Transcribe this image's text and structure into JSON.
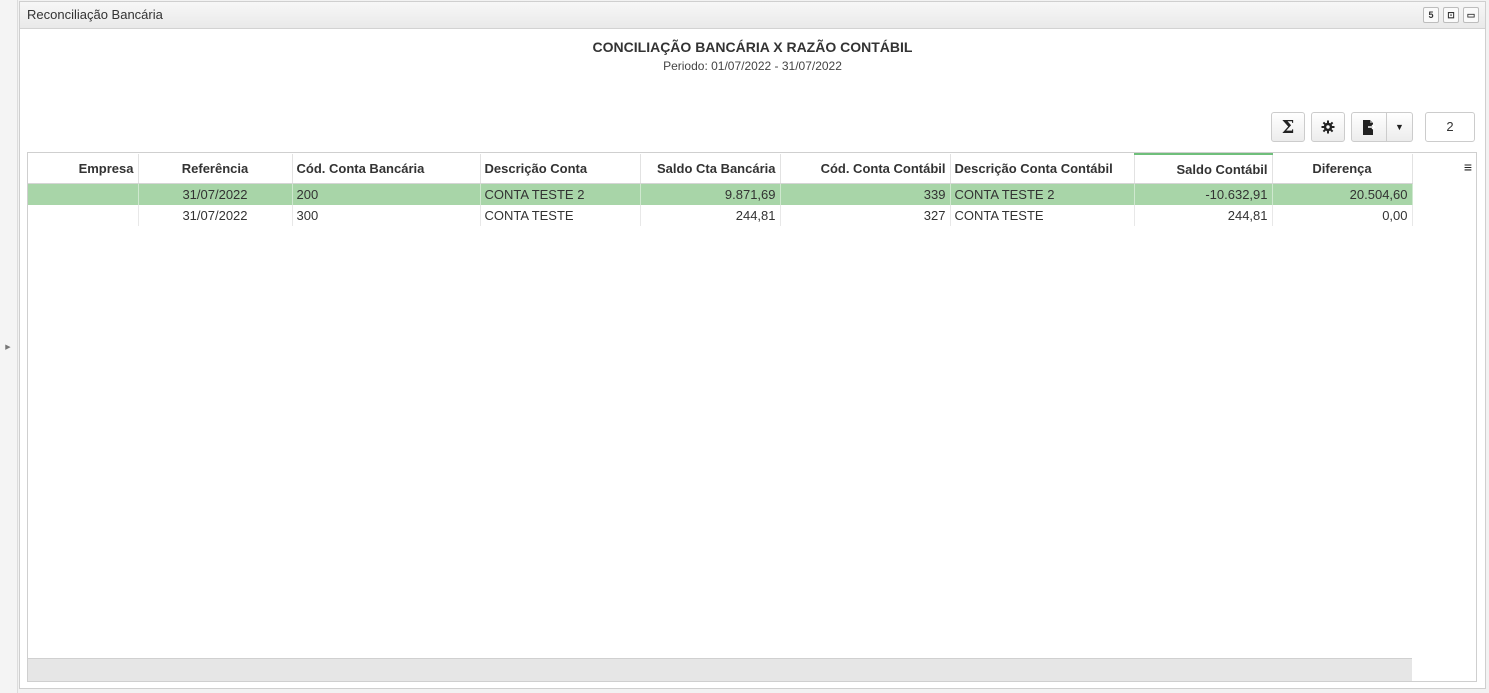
{
  "panel": {
    "title": "Reconciliação Bancária",
    "buttons": [
      "5",
      "⊡",
      "▭"
    ]
  },
  "report": {
    "title": "CONCILIAÇÃO BANCÁRIA X RAZÃO CONTÁBIL",
    "period": "Periodo: 01/07/2022 - 31/07/2022"
  },
  "toolbar": {
    "sum_icon": "sigma-icon",
    "settings_icon": "gear-icon",
    "export_icon": "export-file-icon",
    "dropdown_icon": "caret-down-icon",
    "row_count": "2"
  },
  "grid": {
    "columns": [
      "Empresa",
      "Referência",
      "Cód. Conta Bancária",
      "Descrição Conta",
      "Saldo Cta Bancária",
      "Cód. Conta Contábil",
      "Descrição Conta Contábil",
      "Saldo Contábil",
      "Diferença"
    ],
    "rows": [
      [
        "",
        "31/07/2022",
        "200",
        "CONTA TESTE 2",
        "9.871,69",
        "339",
        "CONTA TESTE 2",
        "-10.632,91",
        "20.504,60"
      ],
      [
        "",
        "31/07/2022",
        "300",
        "CONTA TESTE",
        "244,81",
        "327",
        "CONTA TESTE",
        "244,81",
        "0,00"
      ]
    ],
    "selected_row_color": "#a8d5a8",
    "active_column_accent": "#6fbf7b"
  }
}
